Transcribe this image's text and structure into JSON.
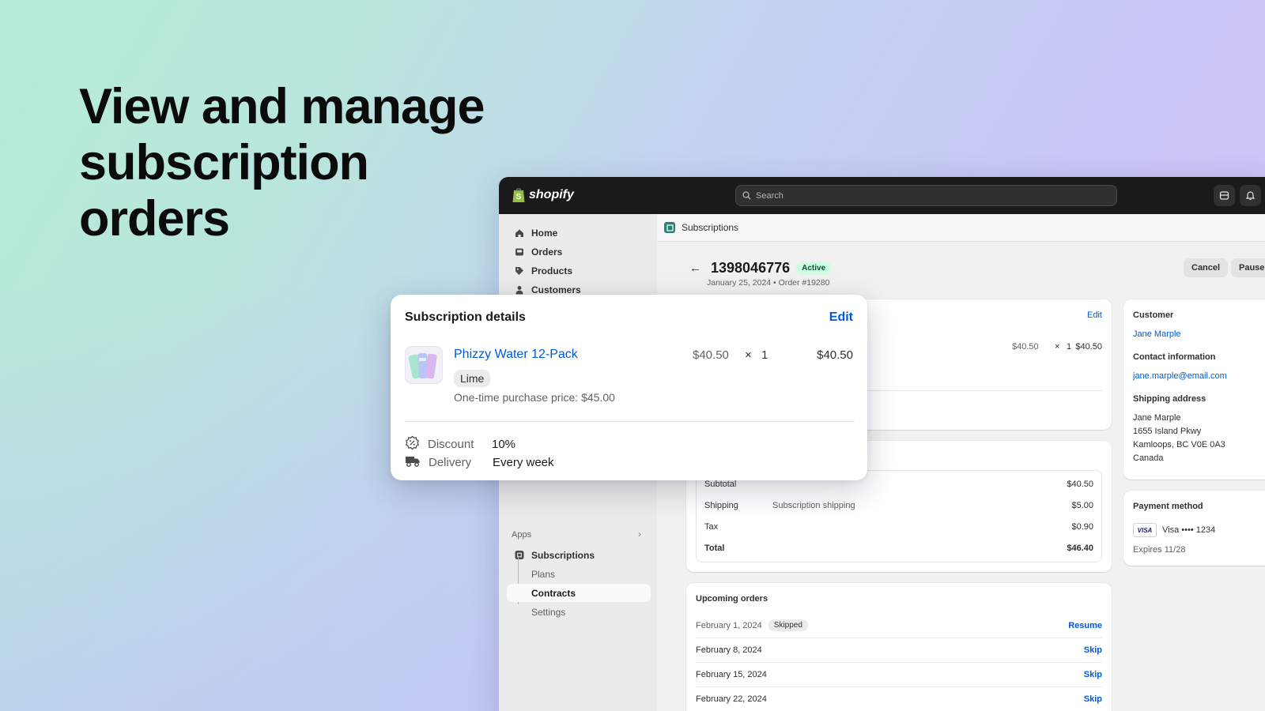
{
  "headline": "View and manage subscription orders",
  "topbar": {
    "brand": "shopify",
    "search_placeholder": "Search"
  },
  "sidebar": {
    "items": [
      {
        "label": "Home",
        "icon": "home-icon"
      },
      {
        "label": "Orders",
        "icon": "inbox-icon"
      },
      {
        "label": "Products",
        "icon": "tag-icon"
      },
      {
        "label": "Customers",
        "icon": "person-icon"
      }
    ],
    "apps_label": "Apps",
    "app_items": [
      {
        "label": "Subscriptions"
      },
      {
        "label": "Plans"
      },
      {
        "label": "Contracts"
      },
      {
        "label": "Settings"
      }
    ]
  },
  "breadcrumb": "Subscriptions",
  "header": {
    "order_id": "1398046776",
    "status": "Active",
    "subtitle": "January 25, 2024 • Order #19280",
    "cancel_label": "Cancel",
    "pause_label": "Pause"
  },
  "details_card": {
    "edit_label": "Edit",
    "price": "$40.50",
    "times": "×",
    "qty": "1",
    "total": "$40.50"
  },
  "summary": {
    "rows": [
      {
        "label": "Subtotal",
        "desc": "",
        "amount": "$40.50"
      },
      {
        "label": "Shipping",
        "desc": "Subscription shipping",
        "amount": "$5.00"
      },
      {
        "label": "Tax",
        "desc": "",
        "amount": "$0.90"
      },
      {
        "label": "Total",
        "desc": "",
        "amount": "$46.40"
      }
    ]
  },
  "upcoming": {
    "title": "Upcoming orders",
    "rows": [
      {
        "date": "February 1, 2024",
        "badge": "Skipped",
        "action": "Resume"
      },
      {
        "date": "February 8, 2024",
        "badge": "",
        "action": "Skip"
      },
      {
        "date": "February 15, 2024",
        "badge": "",
        "action": "Skip"
      },
      {
        "date": "February 22, 2024",
        "badge": "",
        "action": "Skip"
      }
    ]
  },
  "customer_card": {
    "customer_label": "Customer",
    "customer_name": "Jane Marple",
    "contact_label": "Contact information",
    "email": "jane.marple@email.com",
    "shipping_label": "Shipping address",
    "address": [
      "Jane Marple",
      "1655 Island Pkwy",
      "Kamloops, BC V0E 0A3",
      "Canada"
    ]
  },
  "payment_card": {
    "title": "Payment method",
    "card_brand": "VISA",
    "card_text": "Visa •••• 1234",
    "expires": "Expires 11/28"
  },
  "popover": {
    "title": "Subscription details",
    "edit_label": "Edit",
    "product_name": "Phizzy Water 12-Pack",
    "variant": "Lime",
    "one_time": "One-time purchase price: $45.00",
    "price": "$40.50",
    "times": "×",
    "qty": "1",
    "total": "$40.50",
    "discount_label": "Discount",
    "discount_value": "10%",
    "delivery_label": "Delivery",
    "delivery_value": "Every week"
  },
  "colors": {
    "accent_link": "#005bd3",
    "topbar": "#1a1a1a",
    "badge_active_bg": "#cdfee1",
    "badge_active_text": "#0c5132"
  }
}
